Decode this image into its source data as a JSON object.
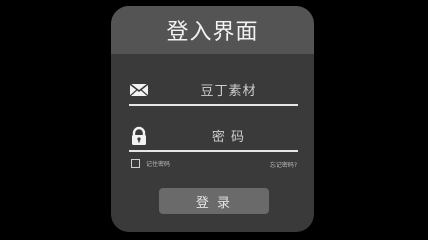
{
  "login_panel": {
    "title": "登入界面",
    "username": {
      "icon": "envelope-icon",
      "placeholder": "豆丁素材"
    },
    "password": {
      "icon": "lock-icon",
      "placeholder": "密 码"
    },
    "remember_me": {
      "label": "记住密码",
      "checked": false
    },
    "forgot_password": "忘记密码?",
    "login_button": "登 录",
    "colors": {
      "background": "#000000",
      "panel": "#3a3a3a",
      "header": "#545454",
      "button": "#6a6a6a",
      "text": "#f2f2f2"
    }
  }
}
